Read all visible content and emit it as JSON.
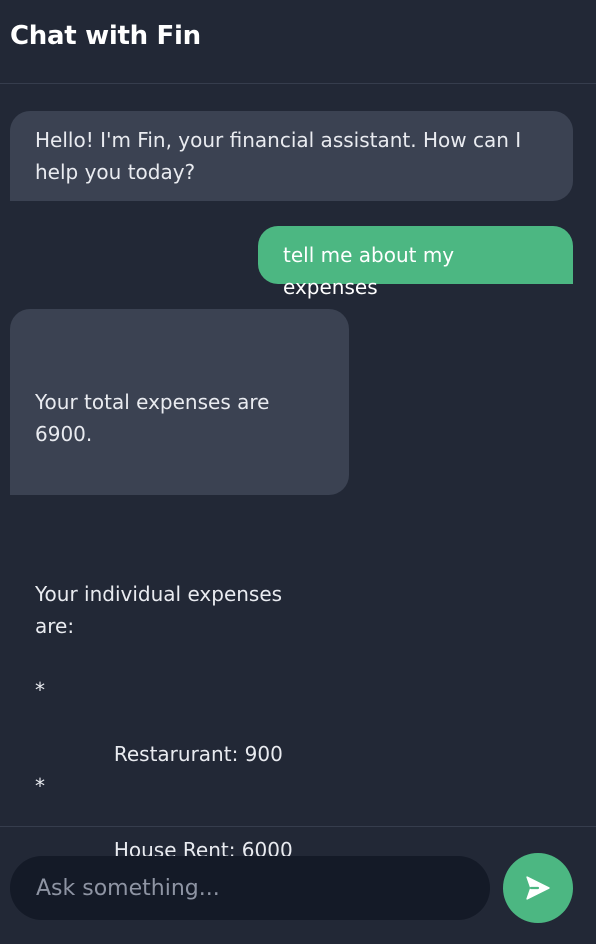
{
  "header": {
    "title": "Chat with Fin"
  },
  "messages": [
    {
      "role": "bot",
      "text": "Hello! I'm Fin, your financial assistant. How can I help you today?"
    },
    {
      "role": "user",
      "text": "tell me about my expenses"
    },
    {
      "role": "bot",
      "intro": "Your total expenses are 6900.",
      "list_heading": "Your individual expenses are:",
      "items": [
        {
          "bullet": "*",
          "text": "Restarurant: 900"
        },
        {
          "bullet": "*",
          "text": "House Rent: 6000"
        }
      ]
    }
  ],
  "composer": {
    "placeholder": "Ask something...",
    "value": "",
    "send_icon": "paper-plane-icon"
  },
  "colors": {
    "background": "#222836",
    "bot_bubble": "#3b4252",
    "user_bubble": "#4cb782",
    "input_background": "#141a27",
    "accent": "#4cb782"
  }
}
